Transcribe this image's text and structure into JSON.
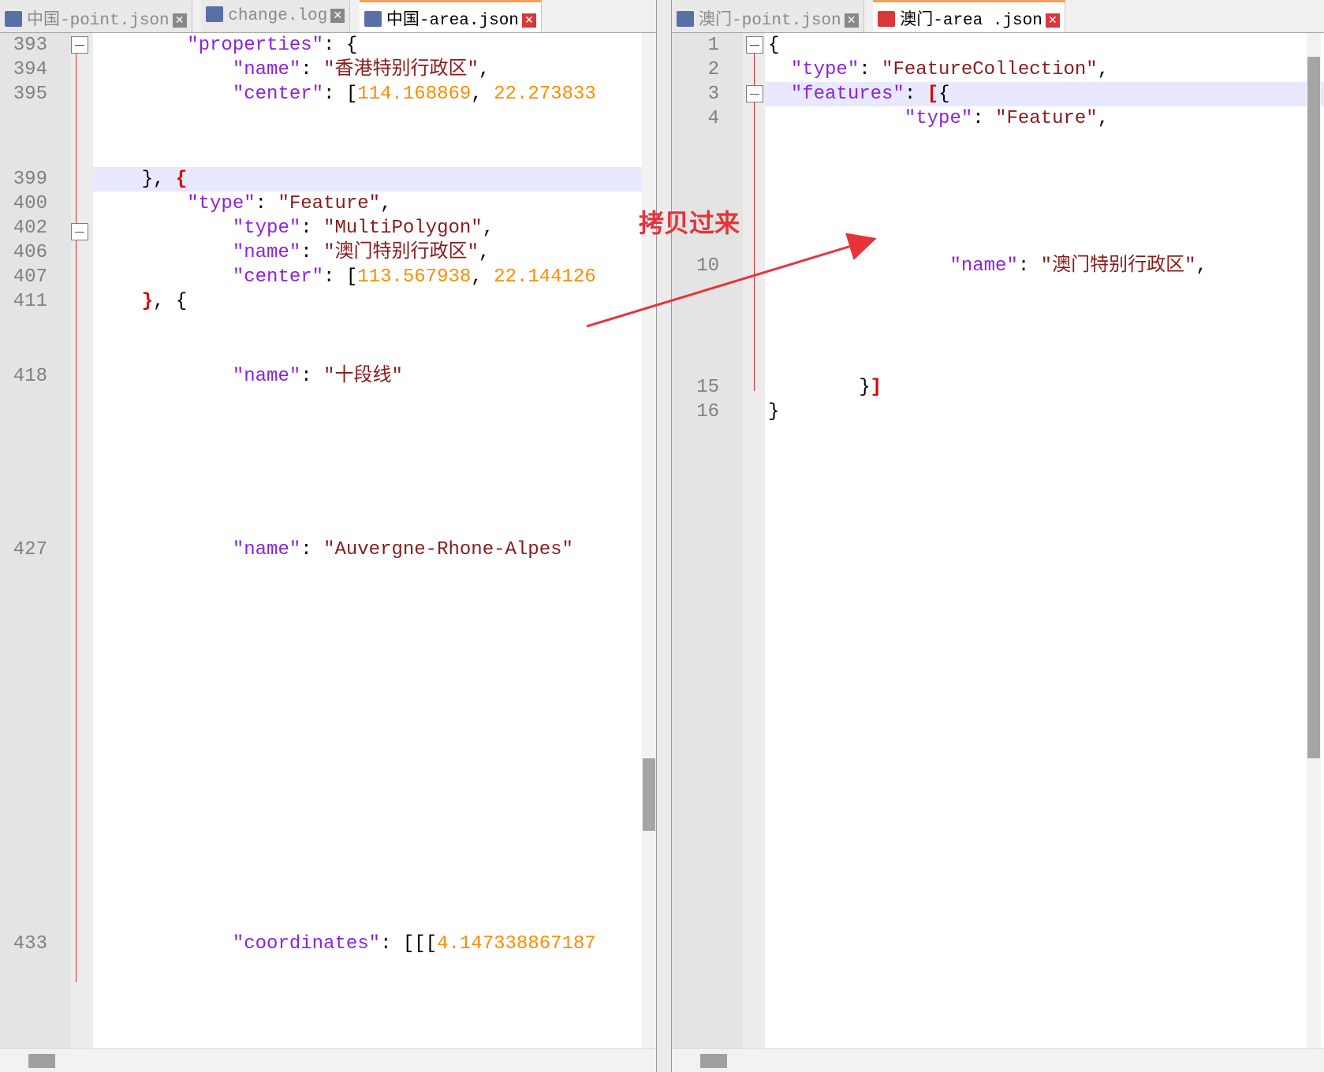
{
  "left_pane": {
    "tabs": [
      {
        "label": "中国-point.json",
        "active": false
      },
      {
        "label": "change.log",
        "active": false
      },
      {
        "label": "中国-area.json",
        "active": true
      }
    ],
    "lines": [
      {
        "n": "393",
        "code": "        <span class=\"k\">\"properties\"</span>: {"
      },
      {
        "n": "394",
        "code": "            <span class=\"k\">\"name\"</span>: <span class=\"s\">\"香港特别行政区\"</span>,"
      },
      {
        "n": "395",
        "code": "            <span class=\"k\">\"center\"</span>: [<span class=\"n\">114.168869</span>, <span class=\"n\">22.273833</span>"
      },
      {
        "n": "399",
        "code": "    }, <span class=\"rb\">{</span>"
      },
      {
        "n": "400",
        "code": "        <span class=\"k\">\"type\"</span>: <span class=\"s\">\"Feature\"</span>,"
      },
      {
        "n": "402",
        "code": "            <span class=\"k\">\"type\"</span>: <span class=\"s\">\"MultiPolygon\"</span>,"
      },
      {
        "n": "406",
        "code": "            <span class=\"k\">\"name\"</span>: <span class=\"s\">\"澳门特别行政区\"</span>,"
      },
      {
        "n": "407",
        "code": "            <span class=\"k\">\"center\"</span>: [<span class=\"n\">113.567938</span>, <span class=\"n\">22.144126</span>"
      },
      {
        "n": "411",
        "code": "    <span class=\"rb\">}</span>, {"
      },
      {
        "n": "418",
        "code": "            <span class=\"k\">\"name\"</span>: <span class=\"s\">\"十段线\"</span>"
      },
      {
        "n": "427",
        "code": "            <span class=\"k\">\"name\"</span>: <span class=\"s\">\"Auvergne-Rhone-Alpes\"</span>"
      },
      {
        "n": "433",
        "code": "            <span class=\"k\">\"coordinates\"</span>: [[[<span class=\"n\">4.147338867187</span>"
      }
    ]
  },
  "right_pane": {
    "tabs": [
      {
        "label": "澳门-point.json",
        "active": false
      },
      {
        "label": "澳门-area .json",
        "active": true
      }
    ],
    "lines": [
      {
        "n": "1",
        "code": "{"
      },
      {
        "n": "2",
        "code": "  <span class=\"k\">\"type\"</span>: <span class=\"s\">\"FeatureCollection\"</span>,"
      },
      {
        "n": "3",
        "code": "  <span class=\"k\">\"features\"</span>: <span class=\"rb\">[</span>{"
      },
      {
        "n": "4",
        "code": "            <span class=\"k\">\"type\"</span>: <span class=\"s\">\"Feature\"</span>,"
      },
      {
        "n": "10",
        "code": "                <span class=\"k\">\"name\"</span>: <span class=\"s\">\"澳门特别行政区\"</span>,"
      },
      {
        "n": "15",
        "code": "        }<span class=\"rb\">]</span>"
      },
      {
        "n": "16",
        "code": "}"
      }
    ]
  },
  "annotation": "拷贝过来"
}
